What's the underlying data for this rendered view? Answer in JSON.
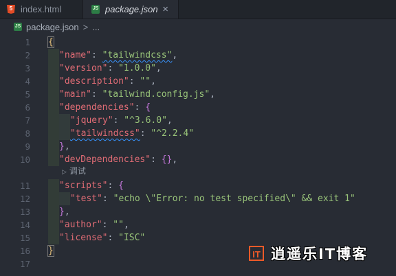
{
  "tabs": [
    {
      "label": "index.html",
      "icon": "html5-icon"
    },
    {
      "label": "package.json",
      "icon": "nodejs-icon",
      "active": true
    }
  ],
  "tab_close_glyph": "×",
  "breadcrumb": {
    "file": "package.json",
    "sep": ">",
    "more": "..."
  },
  "line_numbers": [
    "1",
    "2",
    "3",
    "4",
    "5",
    "6",
    "7",
    "8",
    "9",
    "10",
    "11",
    "12",
    "13",
    "14",
    "15",
    "16",
    "17"
  ],
  "code": {
    "l1": "{",
    "l2_key": "\"name\"",
    "l2_val": "\"tailwindcss\"",
    "l3_key": "\"version\"",
    "l3_val": "\"1.0.0\"",
    "l4_key": "\"description\"",
    "l4_val": "\"\"",
    "l5_key": "\"main\"",
    "l5_val": "\"tailwind.config.js\"",
    "l6_key": "\"dependencies\"",
    "l7_key": "\"jquery\"",
    "l7_val": "\"^3.6.0\"",
    "l8_key": "\"tailwindcss\"",
    "l8_val": "\"^2.2.4\"",
    "l10_key": "\"devDependencies\"",
    "l11_key": "\"scripts\"",
    "l12_key": "\"test\"",
    "l12_val": "\"echo \\\"Error: no test specified\\\" && exit 1\"",
    "l14_key": "\"author\"",
    "l14_val": "\"\"",
    "l15_key": "\"license\"",
    "l15_val": "\"ISC\"",
    "l16": "}"
  },
  "codelens": "调试",
  "watermark": {
    "logo": "IT",
    "text": "逍遥乐IT博客"
  }
}
